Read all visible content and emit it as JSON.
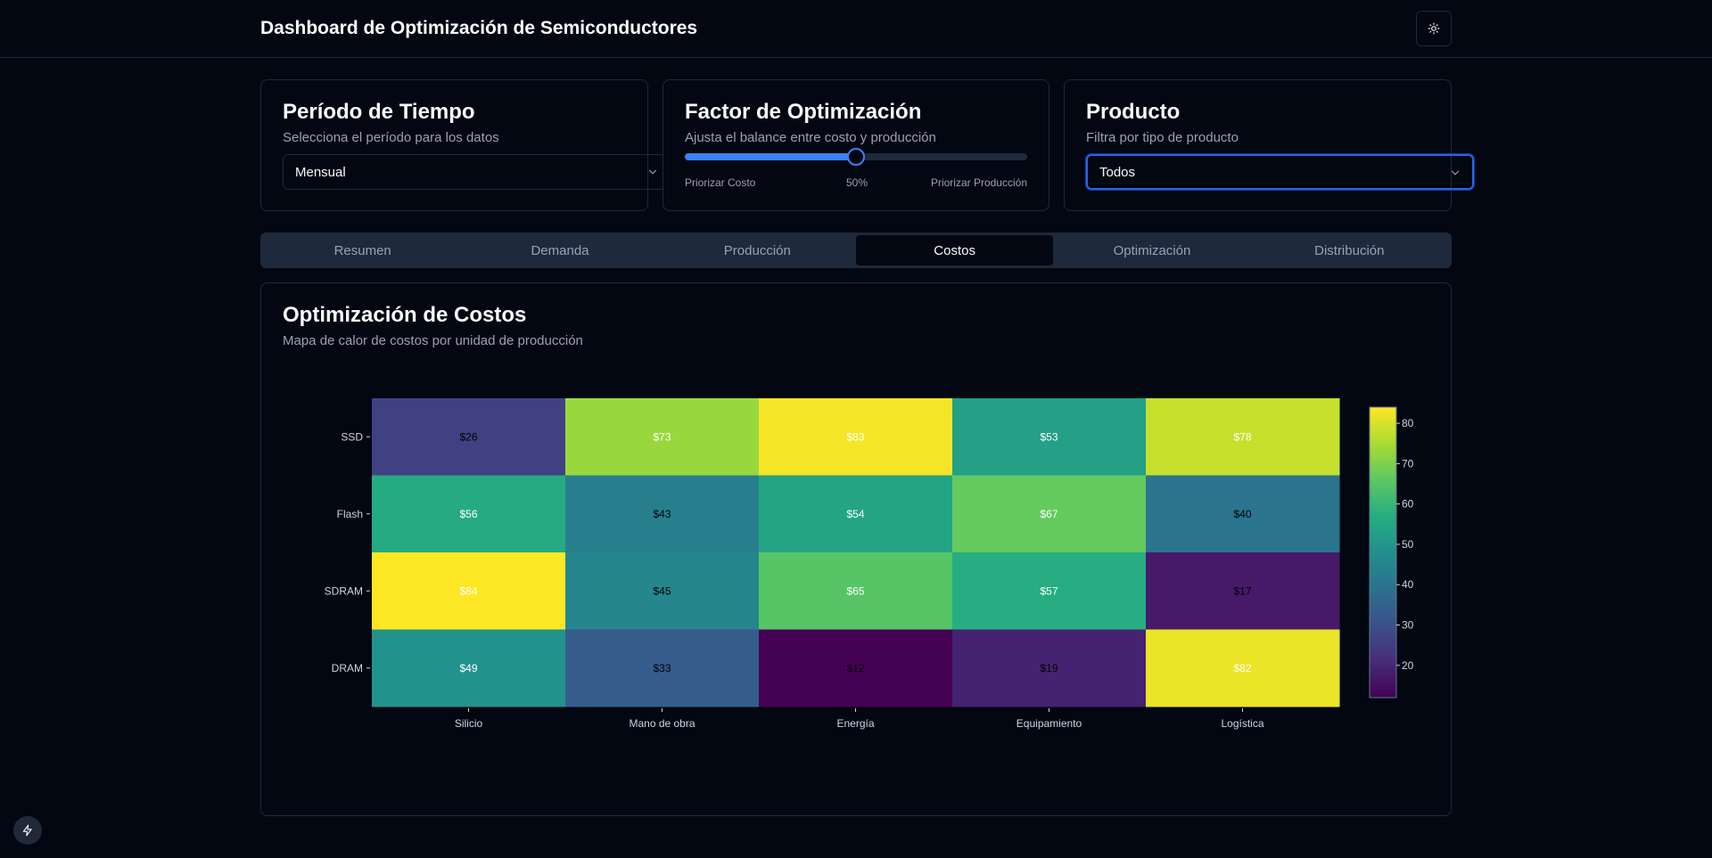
{
  "header": {
    "title": "Dashboard de Optimización de Semiconductores",
    "theme_icon": "sun-icon"
  },
  "period": {
    "title": "Período de Tiempo",
    "description": "Selecciona el período para los datos",
    "value": "Mensual"
  },
  "optimization": {
    "title": "Factor de Optimización",
    "description": "Ajusta el balance entre costo y producción",
    "value_percent": 50,
    "value_label": "50%",
    "min_label": "Priorizar Costo",
    "max_label": "Priorizar Producción"
  },
  "product": {
    "title": "Producto",
    "description": "Filtra por tipo de producto",
    "value": "Todos"
  },
  "tabs": [
    {
      "label": "Resumen",
      "active": false
    },
    {
      "label": "Demanda",
      "active": false
    },
    {
      "label": "Producción",
      "active": false
    },
    {
      "label": "Costos",
      "active": true
    },
    {
      "label": "Optimización",
      "active": false
    },
    {
      "label": "Distribución",
      "active": false
    }
  ],
  "panel": {
    "title": "Optimización de Costos",
    "description": "Mapa de calor de costos por unidad de producción"
  },
  "chart_data": {
    "type": "heatmap",
    "x_categories": [
      "Silicio",
      "Mano de obra",
      "Energía",
      "Equipamiento",
      "Logística"
    ],
    "y_categories": [
      "SSD",
      "Flash",
      "SDRAM",
      "DRAM"
    ],
    "values": [
      [
        26,
        73,
        83,
        53,
        78
      ],
      [
        56,
        43,
        54,
        67,
        40
      ],
      [
        84,
        45,
        65,
        57,
        17
      ],
      [
        49,
        33,
        12,
        19,
        82
      ]
    ],
    "value_prefix": "$",
    "colorscale": "viridis",
    "zrange": [
      12,
      84
    ],
    "colorbar_ticks": [
      20,
      30,
      40,
      50,
      60,
      70,
      80
    ]
  },
  "footer": {
    "icon": "bolt-icon"
  }
}
